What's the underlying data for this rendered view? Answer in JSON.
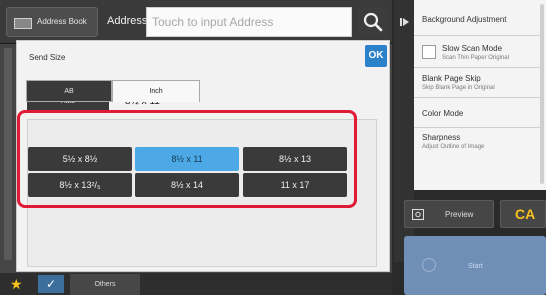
{
  "header": {
    "address_book_label": "Address Book",
    "address_label": "Address",
    "address_placeholder": "Touch to input Address"
  },
  "right_panel": {
    "items": [
      {
        "title": "Background Adjustment",
        "subtitle": ""
      },
      {
        "title": "Slow Scan Mode",
        "subtitle": "Scan Thin Paper Original"
      },
      {
        "title": "Blank Page Skip",
        "subtitle": "Skip Blank Page in Original"
      },
      {
        "title": "Color Mode",
        "subtitle": ""
      },
      {
        "title": "Sharpness",
        "subtitle": "Adjust Outline of Image"
      }
    ],
    "preview_label": "Preview",
    "ca_label": "CA",
    "start_label": "Start"
  },
  "dialog": {
    "title": "Send Size",
    "ok_label": "OK",
    "auto_label": "Auto",
    "current_size": "8½ x 11",
    "tabs": [
      {
        "label": "AB",
        "active": false
      },
      {
        "label": "Inch",
        "active": true
      }
    ],
    "sizes": [
      {
        "label": "5½ x 8½",
        "selected": false
      },
      {
        "label": "8½ x 11",
        "selected": true
      },
      {
        "label": "8½ x 13",
        "selected": false
      },
      {
        "label": "8½ x 13²/₅",
        "selected": false
      },
      {
        "label": "8½ x 14",
        "selected": false
      },
      {
        "label": "11 x 17",
        "selected": false
      }
    ]
  },
  "bottom_bar": {
    "others_label": "Others"
  },
  "colors": {
    "accent_blue": "#2b82c9",
    "selected_blue": "#4da8e6",
    "highlight_red": "#e01b35",
    "ca_yellow": "#f6c21c"
  }
}
